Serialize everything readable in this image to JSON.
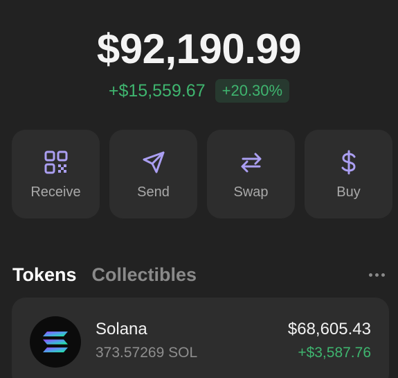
{
  "balance": {
    "total": "$92,190.99",
    "change_amount": "+$15,559.67",
    "change_percent": "+20.30%"
  },
  "actions": [
    {
      "label": "Receive",
      "icon": "qr-code-icon"
    },
    {
      "label": "Send",
      "icon": "send-icon"
    },
    {
      "label": "Swap",
      "icon": "swap-icon"
    },
    {
      "label": "Buy",
      "icon": "dollar-icon"
    }
  ],
  "tabs": {
    "tokens": "Tokens",
    "collectibles": "Collectibles",
    "more_icon": "more-horizontal-icon"
  },
  "tokens": [
    {
      "name": "Solana",
      "amount": "373.57269 SOL",
      "value": "$68,605.43",
      "change": "+$3,587.76",
      "icon": "solana-logo-icon"
    }
  ],
  "colors": {
    "background": "#222222",
    "card": "#2d2d2d",
    "accent": "#ab9ff2",
    "positive": "#3fb56f",
    "muted_text": "#8a8a8a"
  }
}
